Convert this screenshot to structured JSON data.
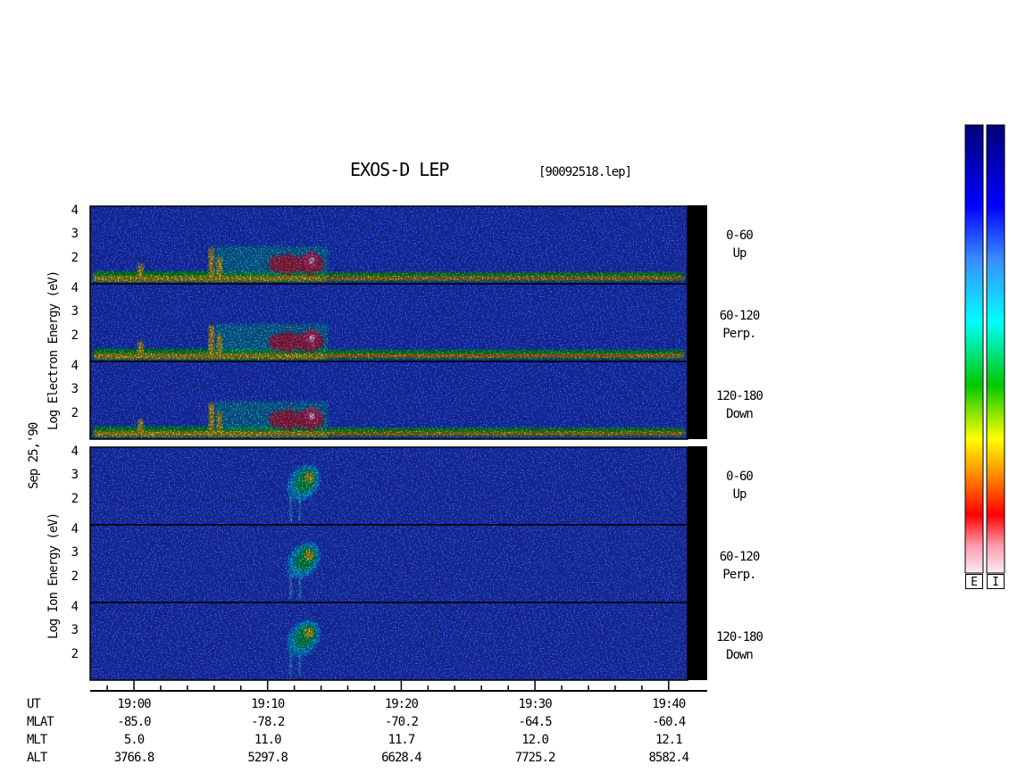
{
  "header": {
    "title": "EXOS-D LEP",
    "filename": "[90092518.lep]"
  },
  "axis_labels": {
    "electron": "Log  Electron  Energy (eV)",
    "ion": "Log  Ion  Energy (eV)",
    "date": "Sep 25,'90"
  },
  "energy_ticks": [
    "4",
    "3",
    "2"
  ],
  "panels": [
    {
      "species": "electron",
      "pitch_range": "0-60",
      "direction": "Up"
    },
    {
      "species": "electron",
      "pitch_range": "60-120",
      "direction": "Perp."
    },
    {
      "species": "electron",
      "pitch_range": "120-180",
      "direction": "Down"
    },
    {
      "species": "ion",
      "pitch_range": "0-60",
      "direction": "Up"
    },
    {
      "species": "ion",
      "pitch_range": "60-120",
      "direction": "Perp."
    },
    {
      "species": "ion",
      "pitch_range": "120-180",
      "direction": "Down"
    }
  ],
  "ephemeris": {
    "labels": {
      "ut": "UT",
      "mlat": "MLAT",
      "mlt": "MLT",
      "alt": "ALT"
    },
    "columns": [
      {
        "ut": "19:00",
        "mlat": "-85.0",
        "mlt": "5.0",
        "alt": "3766.8"
      },
      {
        "ut": "19:10",
        "mlat": "-78.2",
        "mlt": "11.0",
        "alt": "5297.8"
      },
      {
        "ut": "19:20",
        "mlat": "-70.2",
        "mlt": "11.7",
        "alt": "6628.4"
      },
      {
        "ut": "19:30",
        "mlat": "-64.5",
        "mlt": "12.0",
        "alt": "7725.2"
      },
      {
        "ut": "19:40",
        "mlat": "-60.4",
        "mlt": "12.1",
        "alt": "8582.4"
      }
    ]
  },
  "colorbars": {
    "electron_label": "E",
    "ion_label": "I"
  },
  "chart_data": {
    "type": "heatmap",
    "title": "EXOS-D LEP",
    "xlabel": "UT",
    "x_ticks": [
      "19:00",
      "19:10",
      "19:20",
      "19:30",
      "19:40"
    ],
    "x_minutes_range": [
      -2.2,
      41.3
    ],
    "ylabel_electron": "Log Electron Energy (eV)",
    "ylabel_ion": "Log Ion Energy (eV)",
    "y_ticks": [
      "4",
      "3",
      "2"
    ],
    "ylim_log_eV": [
      1,
      4.2
    ],
    "colorscale": [
      "#e7e8f0",
      "#fe0000",
      "#ffff00",
      "#00cc00",
      "#00ffff",
      "#0000ff",
      "#000080"
    ],
    "colorbar_labels": [
      "E",
      "I"
    ],
    "panels": [
      {
        "name": "0-60 Up",
        "species": "electron"
      },
      {
        "name": "60-120 Perp.",
        "species": "electron"
      },
      {
        "name": "120-180 Down",
        "species": "electron"
      },
      {
        "name": "0-60 Up",
        "species": "ion"
      },
      {
        "name": "60-120 Perp.",
        "species": "ion"
      },
      {
        "name": "120-180 Down",
        "species": "ion"
      }
    ]
  }
}
